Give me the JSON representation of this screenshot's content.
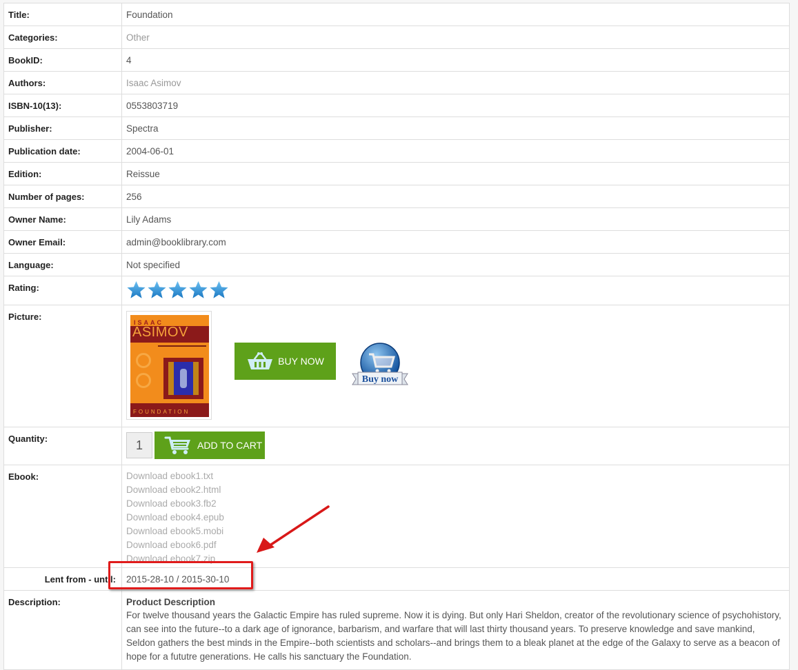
{
  "fields": {
    "title": {
      "label": "Title:",
      "value": "Foundation"
    },
    "categories": {
      "label": "Categories:",
      "value": "Other"
    },
    "book_id": {
      "label": "BookID:",
      "value": "4"
    },
    "authors": {
      "label": "Authors:",
      "value": "Isaac Asimov"
    },
    "isbn": {
      "label": "ISBN-10(13):",
      "value": "0553803719"
    },
    "publisher": {
      "label": "Publisher:",
      "value": "Spectra"
    },
    "publication_date": {
      "label": "Publication date:",
      "value": "2004-06-01"
    },
    "edition": {
      "label": "Edition:",
      "value": "Reissue"
    },
    "pages": {
      "label": "Number of pages:",
      "value": "256"
    },
    "owner_name": {
      "label": "Owner Name:",
      "value": "Lily Adams"
    },
    "owner_email": {
      "label": "Owner Email:",
      "value": "admin@booklibrary.com"
    },
    "language": {
      "label": "Language:",
      "value": "Not specified"
    },
    "rating": {
      "label": "Rating:",
      "stars": 5,
      "max": 5
    },
    "picture": {
      "label": "Picture:",
      "cover": {
        "author_top": "ISAAC",
        "author_band": "ASIMOV",
        "title_bottom": "FOUNDATION"
      },
      "buy_now_label": "BUY NOW",
      "buy_now_image_text": "Buy now"
    },
    "quantity": {
      "label": "Quantity:",
      "value": "1",
      "add_to_cart_label": "ADD TO CART"
    },
    "ebook": {
      "label": "Ebook:",
      "links": [
        "Download ebook1.txt",
        "Download ebook2.html",
        "Download ebook3.fb2",
        "Download ebook4.epub",
        "Download ebook5.mobi",
        "Download ebook6.pdf",
        "Download ebook7.zip"
      ]
    },
    "lent": {
      "label": "Lent from - until:",
      "value": "2015-28-10 / 2015-30-10"
    },
    "description": {
      "label": "Description:",
      "heading": "Product Description",
      "body": "For twelve thousand years the Galactic Empire has ruled supreme. Now it is dying. But only Hari Sheldon, creator of the revolutionary science of psychohistory, can see into the future--to a dark age of ignorance, barbarism, and warfare that will last thirty thousand years. To preserve knowledge and save mankind, Seldon gathers the best minds in the Empire--both scientists and scholars--and brings them to a bleak planet at the edge of the Galaxy to serve as a beacon of hope for a fututre generations. He calls his sanctuary the Foundation."
    }
  },
  "colors": {
    "button_green": "#5ea11a",
    "star_blue": "#2f8fd6",
    "annotation_red": "#e01b1b",
    "link_gray": "#aaaaaa"
  }
}
